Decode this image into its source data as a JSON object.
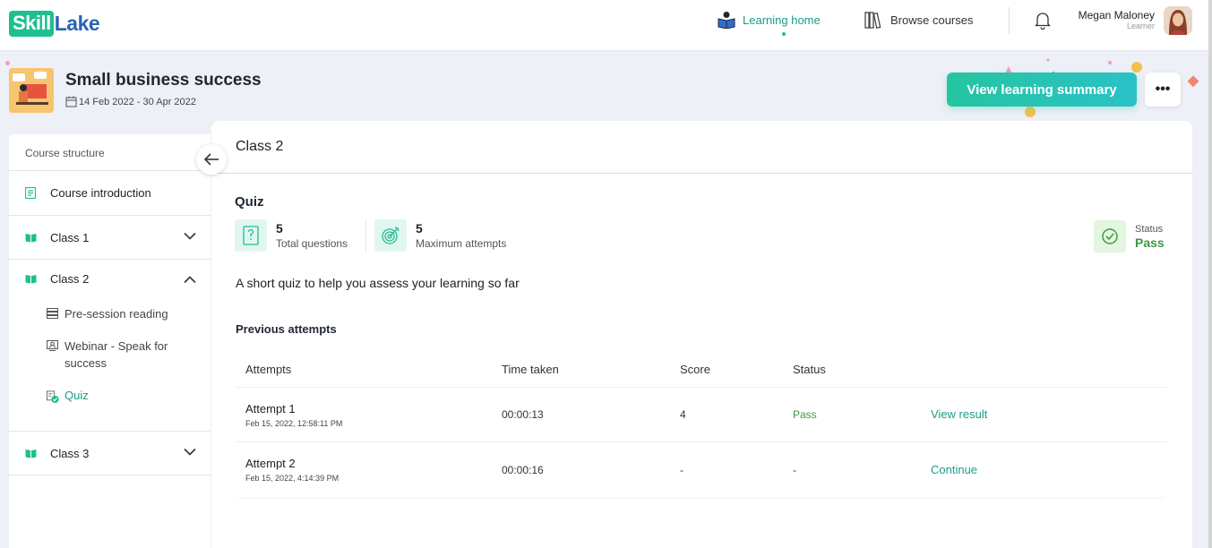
{
  "app": {
    "logo_part1": "Skill",
    "logo_part2": "Lake"
  },
  "nav": {
    "home_label": "Learning home",
    "browse_label": "Browse courses"
  },
  "user": {
    "name": "Megan Maloney",
    "role": "Learner"
  },
  "course": {
    "title": "Small business success",
    "dates": "14 Feb 2022 - 30 Apr 2022",
    "summary_button": "View learning summary",
    "more_button": "•••"
  },
  "sidebar": {
    "heading": "Course structure",
    "intro": "Course introduction",
    "class1": "Class 1",
    "class2": "Class 2",
    "class2_items": [
      {
        "label": "Pre-session reading",
        "icon": "reading-icon"
      },
      {
        "label": "Webinar - Speak for success",
        "icon": "webinar-icon"
      },
      {
        "label": "Quiz",
        "icon": "quiz-icon"
      }
    ],
    "class3": "Class 3"
  },
  "main": {
    "header": "Class 2",
    "quiz_title": "Quiz",
    "total_questions": "5",
    "total_questions_label": "Total questions",
    "max_attempts": "5",
    "max_attempts_label": "Maximum attempts",
    "status_label": "Status",
    "status_value": "Pass",
    "description": "A short quiz to help you assess your learning so far",
    "previous_title": "Previous attempts"
  },
  "table": {
    "columns": [
      "Attempts",
      "Time taken",
      "Score",
      "Status"
    ],
    "rows": [
      {
        "name": "Attempt 1",
        "date": "Feb 15, 2022, 12:58:11 PM",
        "time": "00:00:13",
        "score": "4",
        "status": "Pass",
        "action": "View result"
      },
      {
        "name": "Attempt 2",
        "date": "Feb 15, 2022, 4:14:39 PM",
        "time": "00:00:16",
        "score": "-",
        "status": "-",
        "action": "Continue"
      }
    ]
  },
  "colors": {
    "brand_green": "#1fbf8f",
    "brand_blue": "#2a63b0",
    "accent_teal": "#1a9c86",
    "pass_green": "#3c9a43"
  }
}
